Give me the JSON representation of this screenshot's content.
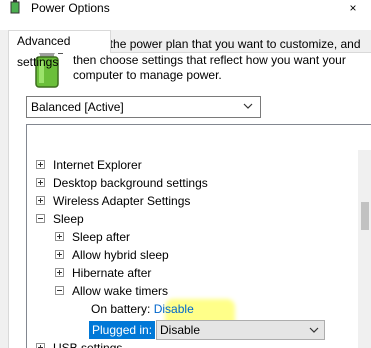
{
  "window": {
    "title": "Power Options",
    "close_glyph": "×"
  },
  "tab": {
    "label": "Advanced settings"
  },
  "description": "Select the power plan that you want to customize, and then choose settings that reflect how you want your computer to manage power.",
  "plan_select": {
    "value": "Balanced [Active]"
  },
  "tree": {
    "items": [
      {
        "label": "Internet Explorer",
        "state": "collapsed"
      },
      {
        "label": "Desktop background settings",
        "state": "collapsed"
      },
      {
        "label": "Wireless Adapter Settings",
        "state": "collapsed"
      },
      {
        "label": "Sleep",
        "state": "expanded"
      },
      {
        "label": "Sleep after",
        "state": "collapsed"
      },
      {
        "label": "Allow hybrid sleep",
        "state": "collapsed"
      },
      {
        "label": "Hibernate after",
        "state": "collapsed"
      },
      {
        "label": "Allow wake timers",
        "state": "expanded"
      },
      {
        "label": "USB settings",
        "state": "collapsed"
      }
    ],
    "on_battery": {
      "label": "On battery:",
      "value": "Disable"
    },
    "plugged_in": {
      "label": "Plugged in:",
      "value": "Disable"
    }
  },
  "colors": {
    "selection": "#0078d7",
    "link": "#0066cc",
    "highlight": "#ffff28"
  },
  "icons": [
    "power-options-icon",
    "close-icon",
    "battery-plan-icon",
    "chevron-down-icon",
    "expand-icon",
    "collapse-icon"
  ]
}
